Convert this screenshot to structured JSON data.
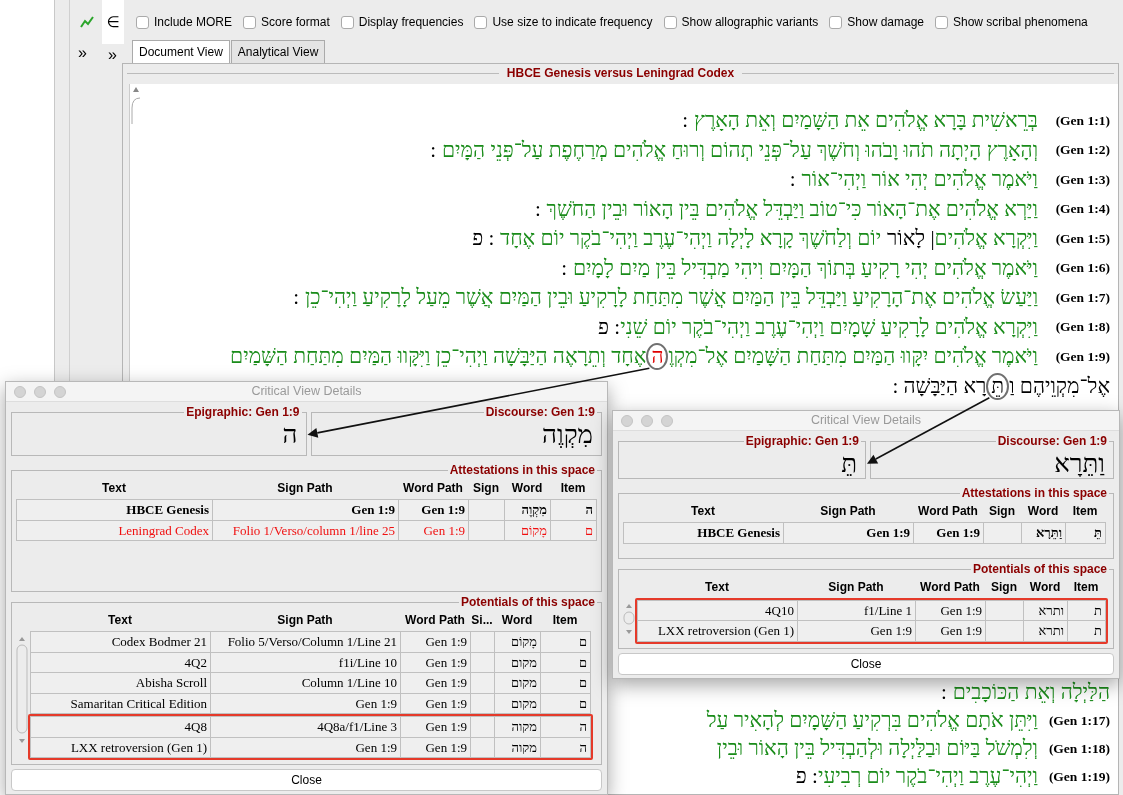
{
  "toolbar": {
    "symbol": "∈",
    "options": [
      {
        "label": "Include MORE",
        "checked": false
      },
      {
        "label": "Score format",
        "checked": false
      },
      {
        "label": "Display frequencies",
        "checked": false
      },
      {
        "label": "Use size to indicate frequency",
        "checked": false
      },
      {
        "label": "Show allographic variants",
        "checked": false
      },
      {
        "label": "Show damage",
        "checked": false
      },
      {
        "label": "Show scribal phenomena",
        "checked": false
      }
    ]
  },
  "expand_buttons": [
    "»",
    "»"
  ],
  "tabs": [
    {
      "label": "Document View",
      "selected": true
    },
    {
      "label": "Analytical View",
      "selected": false
    }
  ],
  "document": {
    "title": "HBCE Genesis versus Leningrad Codex",
    "lines": [
      {
        "ref": "(Gen 1:1)",
        "segments": [
          {
            "text": ":",
            "color": "#000000",
            "kind": "mark"
          },
          {
            "text": "בְּרֵאשִׁית בָּרָא אֱלֹהִים אֵת הַשָּׁמַיִם וְאֵת הָאָרֶץ",
            "color": "#1a8c1a",
            "kind": "words"
          }
        ]
      },
      {
        "ref": "(Gen 1:2)",
        "segments": [
          {
            "text": ":",
            "color": "#000000",
            "kind": "mark"
          },
          {
            "text": "וְהָאָרֶץ הָיְתָה תֹהוּ וָבֹהוּ וְחֹשֶׁךְ עַל־פְּנֵי תְהוֹם וְרוּחַ אֱלֹהִים מְרַחֶפֶת עַל־פְּנֵי הַמָּיִם",
            "color": "#1a8c1a",
            "kind": "words"
          }
        ]
      },
      {
        "ref": "(Gen 1:3)",
        "segments": [
          {
            "text": ":",
            "color": "#000000",
            "kind": "mark"
          },
          {
            "text": "וַיֹּאמֶר אֱלֹהִים יְהִי אוֹר וַיְהִי־אוֹר",
            "color": "#1a8c1a",
            "kind": "words"
          }
        ]
      },
      {
        "ref": "(Gen 1:4)",
        "segments": [
          {
            "text": ":",
            "color": "#000000",
            "kind": "mark"
          },
          {
            "text": "וַיַּרְא אֱלֹהִים אֶת־הָאוֹר כִּי־טוֹב וַיַּבְדֵּל אֱלֹהִים בֵּין הָאוֹר וּבֵין הַחֹשֶׁךְ",
            "color": "#1a8c1a",
            "kind": "words"
          }
        ]
      },
      {
        "ref": "(Gen 1:5)",
        "segments": [
          {
            "text": "וַיִּקְרָא אֱלֹהִים",
            "color": "#1a8c1a",
            "kind": "words"
          },
          {
            "text": "| לָאוֹר",
            "color": "#000000",
            "kind": "words"
          },
          {
            "text": "יוֹם וְלַחֹשֶׁךְ קָרָא לָיְלָה וַיְהִי־עֶרֶב וַיְהִי־בֹקֶר יוֹם אֶחָד",
            "color": "#1a8c1a",
            "kind": "words"
          },
          {
            "text": ": פ",
            "color": "#000000",
            "kind": "mark"
          }
        ]
      },
      {
        "ref": "(Gen 1:6)",
        "segments": [
          {
            "text": ":",
            "color": "#000000",
            "kind": "mark"
          },
          {
            "text": "וַיֹּאמֶר אֱלֹהִים יְהִי רָקִיעַ בְּתוֹךְ הַמָּיִם וִיהִי מַבְדִּיל בֵּין מַיִם לָמָיִם",
            "color": "#1a8c1a",
            "kind": "words"
          }
        ]
      },
      {
        "ref": "(Gen 1:7)",
        "segments": [
          {
            "text": ":",
            "color": "#000000",
            "kind": "mark"
          },
          {
            "text": "וַיַּעַשׂ אֱלֹהִים אֶת־הָרָקִיעַ וַיַּבְדֵּל בֵּין הַמַּיִם אֲשֶׁר מִתַּחַת לָרָקִיעַ וּבֵין הַמַּיִם אֲשֶׁר מֵעַל לָרָקִיעַ וַיְהִי־כֵן",
            "color": "#1a8c1a",
            "kind": "words"
          }
        ]
      },
      {
        "ref": "(Gen 1:8)",
        "segments": [
          {
            "text": "וַיִּקְרָא אֱלֹהִים לָרָקִיעַ שָׁמָיִם וַיְהִי־עֶרֶב וַיְהִי־בֹקֶר יוֹם שֵׁנִי",
            "color": "#1a8c1a",
            "kind": "words"
          },
          {
            "text": ": פ",
            "color": "#000000",
            "kind": "mark"
          }
        ]
      },
      {
        "ref": "(Gen 1:9)",
        "segments": [
          {
            "text": "וַיֹּאמֶר אֱלֹהִים יִקָּווּ הַמַּיִם מִתַּחַת הַשָּׁמַיִם אֶל־מִקְוֶ",
            "color": "#1a8c1a",
            "kind": "words"
          },
          {
            "text": "ה",
            "color": "#e00000",
            "circled": true,
            "attached": true,
            "kind": "words"
          },
          {
            "text": "אֶחָד וְתֵרָאֶה הַיַּבָּשָׁה וַיְהִי־כֵן וַיִּקָּווּ הַמַּיִם מִתַּחַת הַשָּׁמַיִם",
            "color": "#1a8c1a",
            "kind": "words"
          }
        ]
      },
      {
        "segments": [
          {
            "text": "אֶל־מִקְוֵיהֶם וַ",
            "color": "#000000",
            "kind": "words"
          },
          {
            "text": "תֵּ",
            "color": "#000000",
            "circled": true,
            "attached": true,
            "kind": "words"
          },
          {
            "text": "רָא הַיַּבָּשָׁה :",
            "color": "#000000",
            "attached": true,
            "kind": "words"
          }
        ]
      }
    ],
    "lines_below": [
      {
        "segments": [
          {
            "text": ":",
            "color": "#000000",
            "kind": "mark"
          },
          {
            "text": "הַלַּיְלָה וְאֵת הַכּוֹכָבִים",
            "color": "#1a8c1a",
            "kind": "words"
          }
        ]
      },
      {
        "ref": "(Gen 1:17)",
        "segments": [
          {
            "text": "וַיִּתֵּן אֹתָם אֱלֹהִים בִּרְקִיעַ הַשָּׁמָיִם לְהָאִיר עַל",
            "color": "#1a8c1a"
          }
        ]
      },
      {
        "ref": "(Gen 1:18)",
        "segments": [
          {
            "text": "וְלִמְשֹׁל בַּיּוֹם וּבַלַּיְלָה וּלְהַבְדִּיל בֵּין הָאוֹר וּבֵין",
            "color": "#1a8c1a"
          }
        ]
      },
      {
        "ref": "(Gen 1:19)",
        "segments": [
          {
            "text": "וַיְהִי־עֶרֶב וַיְהִי־בֹקֶר יוֹם רְבִיעִי",
            "color": "#1a8c1a",
            "kind": "words"
          },
          {
            "text": ": פ",
            "color": "#000000",
            "kind": "mark"
          }
        ]
      }
    ]
  },
  "dialogs": [
    {
      "title": "Critical View Details",
      "epigraphic": {
        "label": "Epigraphic:  Gen 1:9",
        "sign": "ה"
      },
      "discourse": {
        "label": "Discourse:  Gen 1:9",
        "word": "מִקְוֶה"
      },
      "attestations": {
        "title": "Attestations in this space",
        "columns": [
          "Text",
          "Sign Path",
          "Word Path",
          "Sign",
          "Word",
          "Item"
        ],
        "rows": [
          {
            "cells": [
              "HBCE Genesis",
              "Gen 1:9",
              "Gen 1:9",
              "",
              "מִקְוֶה",
              "ה"
            ],
            "primary": true,
            "differs": false
          },
          {
            "cells": [
              "Leningrad Codex",
              "Folio 1/Verso/column 1/line 25",
              "Gen 1:9",
              "",
              "מָקוֹם",
              "ם"
            ],
            "primary": false,
            "differs": true
          }
        ]
      },
      "potentials": {
        "title": "Potentials of this space",
        "columns": [
          "Text",
          "Sign Path",
          "Word Path",
          "Si...",
          "Word",
          "Item"
        ],
        "rows": [
          {
            "cells": [
              "Codex Bodmer 21",
              "Folio 5/Verso/Column 1/Line 21",
              "Gen 1:9",
              "",
              "מָקוֹם",
              "ם"
            ],
            "highlighted": false
          },
          {
            "cells": [
              "4Q2",
              "f1i/Line 10",
              "Gen 1:9",
              "",
              "מקום",
              "ם"
            ],
            "highlighted": false
          },
          {
            "cells": [
              "Abisha Scroll",
              "Column 1/Line 10",
              "Gen 1:9",
              "",
              "מקום",
              "ם"
            ],
            "highlighted": false
          },
          {
            "cells": [
              "Samaritan Critical Edition",
              "Gen 1:9",
              "Gen 1:9",
              "",
              "מקום",
              "ם"
            ],
            "highlighted": false
          },
          {
            "cells": [
              "4Q8",
              "4Q8a/f1/Line 3",
              "Gen 1:9",
              "",
              "מקוה",
              "ה"
            ],
            "highlighted": true
          },
          {
            "cells": [
              "LXX retroversion (Gen 1)",
              "Gen 1:9",
              "Gen 1:9",
              "",
              "מקוה",
              "ה"
            ],
            "highlighted": true
          }
        ]
      },
      "close": "Close"
    },
    {
      "title": "Critical View Details",
      "epigraphic": {
        "label": "Epigraphic:  Gen 1:9",
        "sign": "תֵּ"
      },
      "discourse": {
        "label": "Discourse:  Gen 1:9",
        "word": "וַתֵּרָא"
      },
      "attestations": {
        "title": "Attestations in this space",
        "columns": [
          "Text",
          "Sign Path",
          "Word Path",
          "Sign",
          "Word",
          "Item"
        ],
        "rows": [
          {
            "cells": [
              "HBCE Genesis",
              "Gen 1:9",
              "Gen 1:9",
              "",
              "וַתֵּרָא",
              "תֵּ"
            ],
            "primary": true,
            "differs": false
          }
        ]
      },
      "potentials": {
        "title": "Potentials of this space",
        "columns": [
          "Text",
          "Sign Path",
          "Word Path",
          "Sign",
          "Word",
          "Item"
        ],
        "rows": [
          {
            "cells": [
              "4Q10",
              "f1/Line 1",
              "Gen 1:9",
              "",
              "ותרא",
              "ת"
            ],
            "highlighted": true
          },
          {
            "cells": [
              "LXX retroversion (Gen 1)",
              "Gen 1:9",
              "Gen 1:9",
              "",
              "ותרא",
              "ת"
            ],
            "highlighted": true
          }
        ]
      },
      "close": "Close"
    }
  ]
}
